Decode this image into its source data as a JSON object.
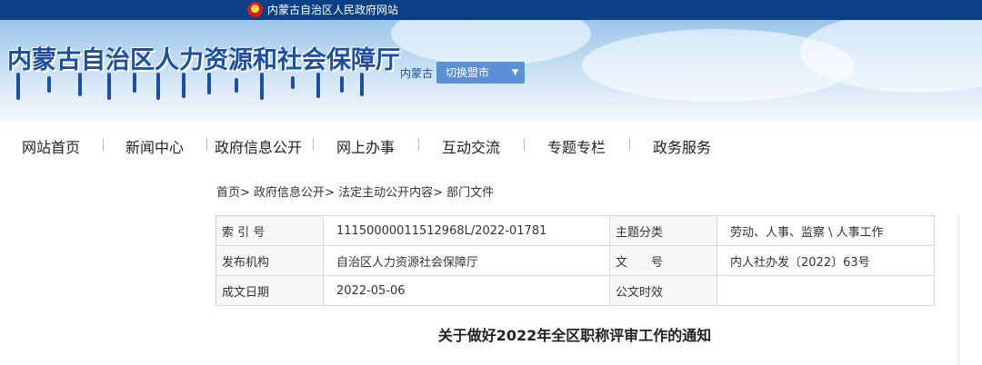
{
  "topbar": {
    "gov_site": "内蒙古自治区人民政府网站"
  },
  "banner": {
    "site_title": "内蒙古自治区人力资源和社会保障厅",
    "region_label": "内蒙古",
    "city_select": "切换盟市"
  },
  "nav": {
    "items": [
      "网站首页",
      "新闻中心",
      "政府信息公开",
      "网上办事",
      "互动交流",
      "专题专栏",
      "政务服务"
    ]
  },
  "breadcrumb": {
    "home": "首页",
    "gov_info": "政府信息公开",
    "statutory": "法定主动公开内容",
    "dept_docs": "部门文件"
  },
  "meta_table": {
    "index_label": "索 引 号",
    "index_value": "11150000011512968L/2022-01781",
    "category_label": "主题分类",
    "category_value": "劳动、人事、监察 \\ 人事工作",
    "issuer_label": "发布机构",
    "issuer_value": "自治区人力资源社会保障厅",
    "doc_no_label": "文　　号",
    "doc_no_value": "内人社办发〔2022〕63号",
    "date_label": "成文日期",
    "date_value": "2022-05-06",
    "validity_label": "公文时效",
    "validity_value": ""
  },
  "article": {
    "title": "关于做好2022年全区职称评审工作的通知"
  }
}
